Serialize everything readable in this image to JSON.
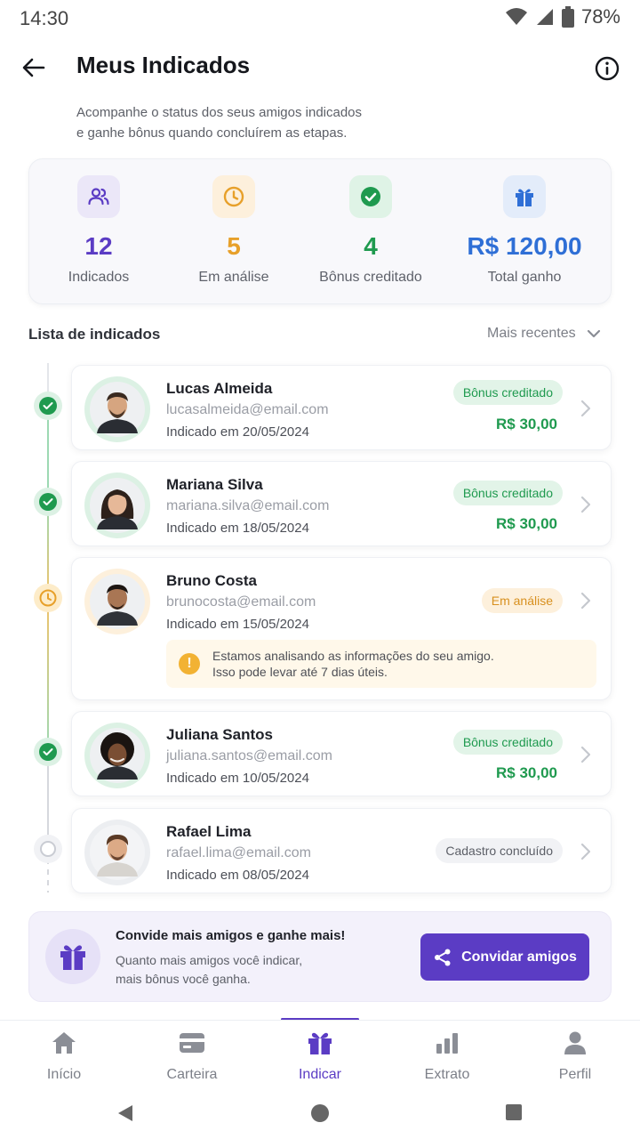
{
  "status_bar": {
    "time": "14:30",
    "battery": "78%"
  },
  "header": {
    "title": "Meus Indicados",
    "subtitle_line1": "Acompanhe o status dos seus amigos indicados",
    "subtitle_line2": "e ganhe bônus quando concluírem as etapas."
  },
  "stats": [
    {
      "value": "12",
      "label": "Indicados",
      "icon": "users-icon",
      "color": "#5b3cc4",
      "bg": "#ebe7f8"
    },
    {
      "value": "5",
      "label": "Em análise",
      "icon": "clock-icon",
      "color": "#e7a02a",
      "bg": "#fdf0dc"
    },
    {
      "value": "4",
      "label": "Bônus creditado",
      "icon": "check-circle-icon",
      "color": "#1f9a4f",
      "bg": "#dff3e6"
    },
    {
      "value": "R$ 120,00",
      "label": "Total ganho",
      "icon": "gift-icon",
      "color": "#2f6fd6",
      "bg": "#e3ecfa"
    }
  ],
  "list": {
    "title": "Lista de indicados",
    "sort_label": "Mais recentes"
  },
  "referrals": [
    {
      "name": "Lucas Almeida",
      "email": "lucasalmeida@email.com",
      "date": "Indicado em 20/05/2024",
      "status": "Bônus creditado",
      "status_type": "credited",
      "amount": "R$ 30,00"
    },
    {
      "name": "Mariana Silva",
      "email": "mariana.silva@email.com",
      "date": "Indicado em 18/05/2024",
      "status": "Bônus creditado",
      "status_type": "credited",
      "amount": "R$ 30,00"
    },
    {
      "name": "Bruno Costa",
      "email": "brunocosta@email.com",
      "date": "Indicado em 15/05/2024",
      "status": "Em análise",
      "status_type": "analysis",
      "amount": "",
      "note_line1": "Estamos analisando as informações do seu amigo.",
      "note_line2": "Isso pode levar até 7 dias úteis."
    },
    {
      "name": "Juliana Santos",
      "email": "juliana.santos@email.com",
      "date": "Indicado em 10/05/2024",
      "status": "Bônus creditado",
      "status_type": "credited",
      "amount": "R$ 30,00"
    },
    {
      "name": "Rafael Lima",
      "email": "rafael.lima@email.com",
      "date": "Indicado em 08/05/2024",
      "status": "Cadastro concluído",
      "status_type": "registered",
      "amount": ""
    }
  ],
  "invite": {
    "title": "Convide mais amigos e ganhe mais!",
    "desc_line1": "Quanto mais amigos você indicar,",
    "desc_line2": "mais bônus você ganha.",
    "button": "Convidar amigos"
  },
  "bottom_nav": [
    {
      "label": "Início",
      "icon": "home-icon",
      "active": false
    },
    {
      "label": "Carteira",
      "icon": "wallet-icon",
      "active": false
    },
    {
      "label": "Indicar",
      "icon": "gift-icon",
      "active": true
    },
    {
      "label": "Extrato",
      "icon": "bar-chart-icon",
      "active": false
    },
    {
      "label": "Perfil",
      "icon": "person-icon",
      "active": false
    }
  ],
  "colors": {
    "primary": "#5b3cc4",
    "success": "#1f9a4f",
    "warning": "#e7a02a",
    "info": "#2f6fd6"
  }
}
